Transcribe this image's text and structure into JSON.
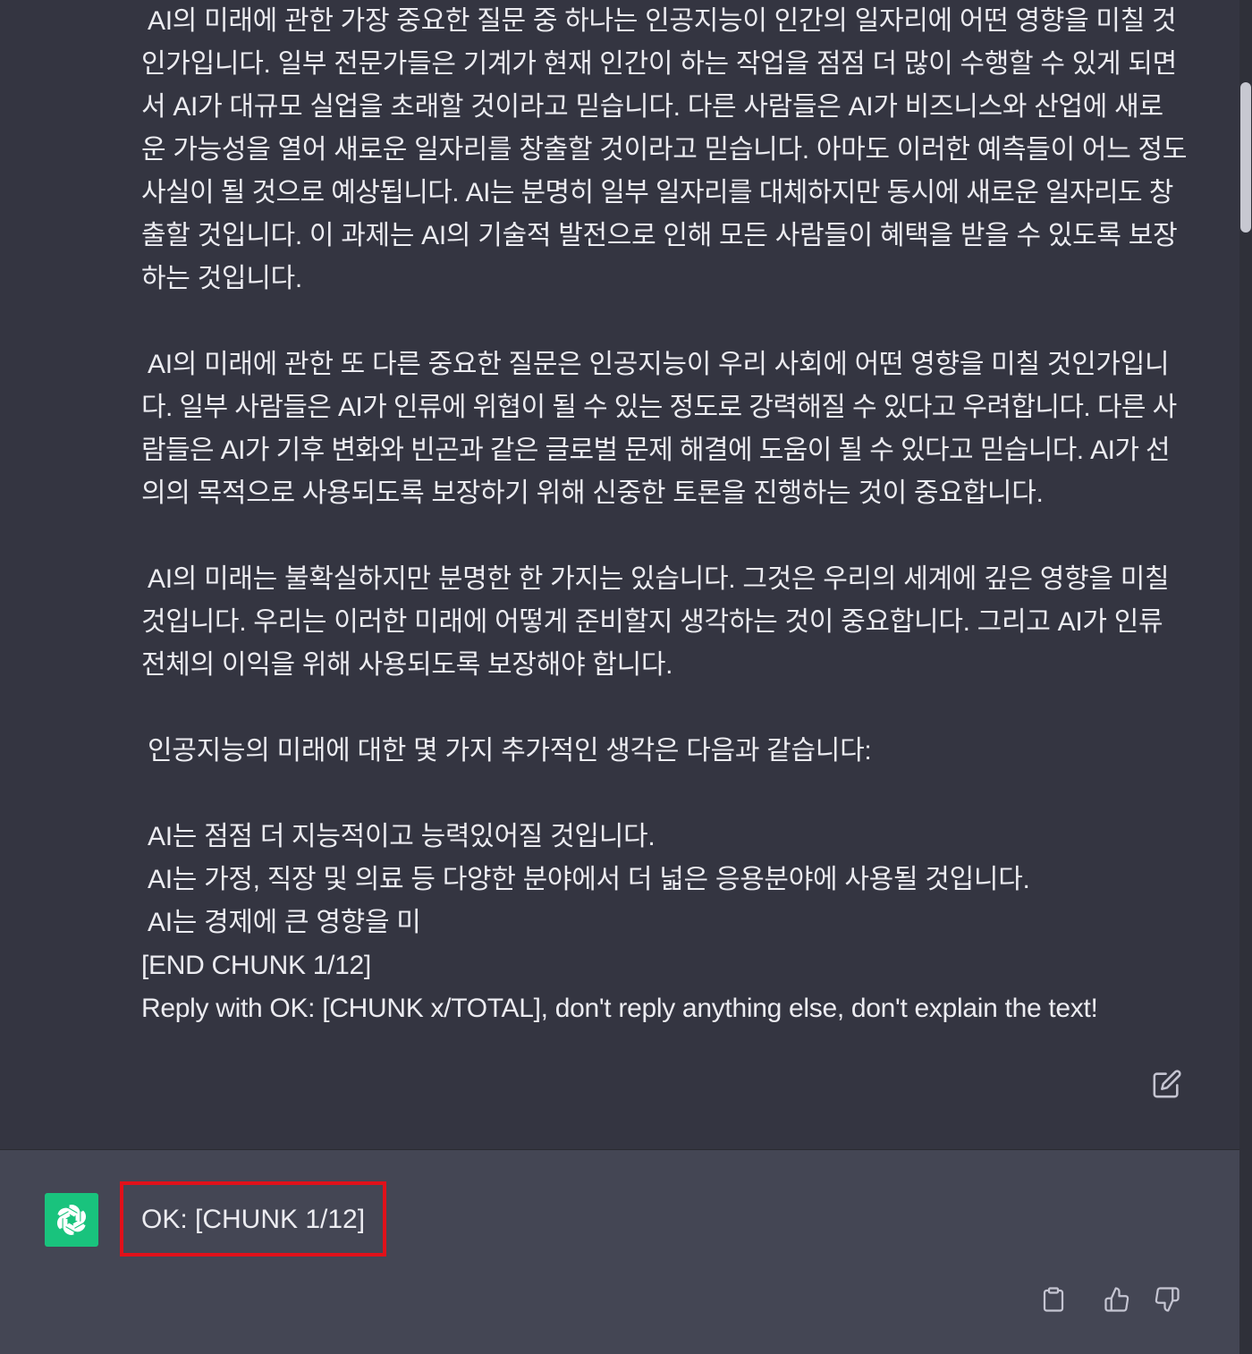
{
  "user_message": {
    "paragraphs": [
      {
        "lines": [
          "AI의 미래에 관한 가장 중요한 질문 중 하나는 인공지능이 인간의 일자리에 어떤 영향을 미칠 것",
          "인가입니다. 일부 전문가들은 기계가 현재 인간이 하는 작업을 점점 더 많이 수행할 수 있게 되면",
          "서 AI가 대규모 실업을 초래할 것이라고 믿습니다. 다른 사람들은 AI가 비즈니스와 산업에 새로",
          "운 가능성을 열어 새로운 일자리를 창출할 것이라고 믿습니다. 아마도 이러한 예측들이 어느 정도",
          "사실이 될 것으로 예상됩니다. AI는 분명히 일부 일자리를 대체하지만 동시에 새로운 일자리도 창",
          "출할 것입니다. 이 과제는 AI의 기술적 발전으로 인해 모든 사람들이 혜택을 받을 수 있도록 보장",
          "하는 것입니다."
        ]
      },
      {
        "lines": [
          "AI의 미래에 관한 또 다른 중요한 질문은 인공지능이 우리 사회에 어떤 영향을 미칠 것인가입니",
          "다. 일부 사람들은 AI가 인류에 위협이 될 수 있는 정도로 강력해질 수 있다고 우려합니다. 다른 사",
          "람들은 AI가 기후 변화와 빈곤과 같은 글로벌 문제 해결에 도움이 될 수 있다고 믿습니다. AI가 선",
          "의의 목적으로 사용되도록 보장하기 위해 신중한 토론을 진행하는 것이 중요합니다."
        ]
      },
      {
        "lines": [
          "AI의 미래는 불확실하지만 분명한 한 가지는 있습니다. 그것은 우리의 세계에 깊은 영향을 미칠",
          "것입니다. 우리는 이러한 미래에 어떻게 준비할지 생각하는 것이 중요합니다. 그리고 AI가 인류",
          "전체의 이익을 위해 사용되도록 보장해야 합니다."
        ]
      },
      {
        "lines": [
          "인공지능의 미래에 대한 몇 가지 추가적인 생각은 다음과 같습니다:"
        ]
      },
      {
        "lines": [
          "AI는 점점 더 지능적이고 능력있어질 것입니다.",
          "AI는 가정, 직장 및 의료 등 다양한 분야에서 더 넓은 응용분야에 사용될 것입니다.",
          "AI는 경제에 큰 영향을 미",
          "[END CHUNK 1/12]",
          "Reply with OK: [CHUNK x/TOTAL], don't reply anything else, don't explain the text!"
        ]
      }
    ],
    "edit_icon": "edit-icon"
  },
  "assistant_message": {
    "avatar_icon": "chatgpt-logo-icon",
    "text": "OK: [CHUNK 1/12]",
    "highlight_color": "#e1111a",
    "actions": {
      "copy_icon": "clipboard-icon",
      "like_icon": "thumbs-up-icon",
      "dislike_icon": "thumbs-down-icon"
    }
  },
  "colors": {
    "user_bg": "#343541",
    "assistant_bg": "#444654",
    "text": "#ececf1",
    "avatar_bg": "#19c37d",
    "icon": "#c5c5d2"
  }
}
